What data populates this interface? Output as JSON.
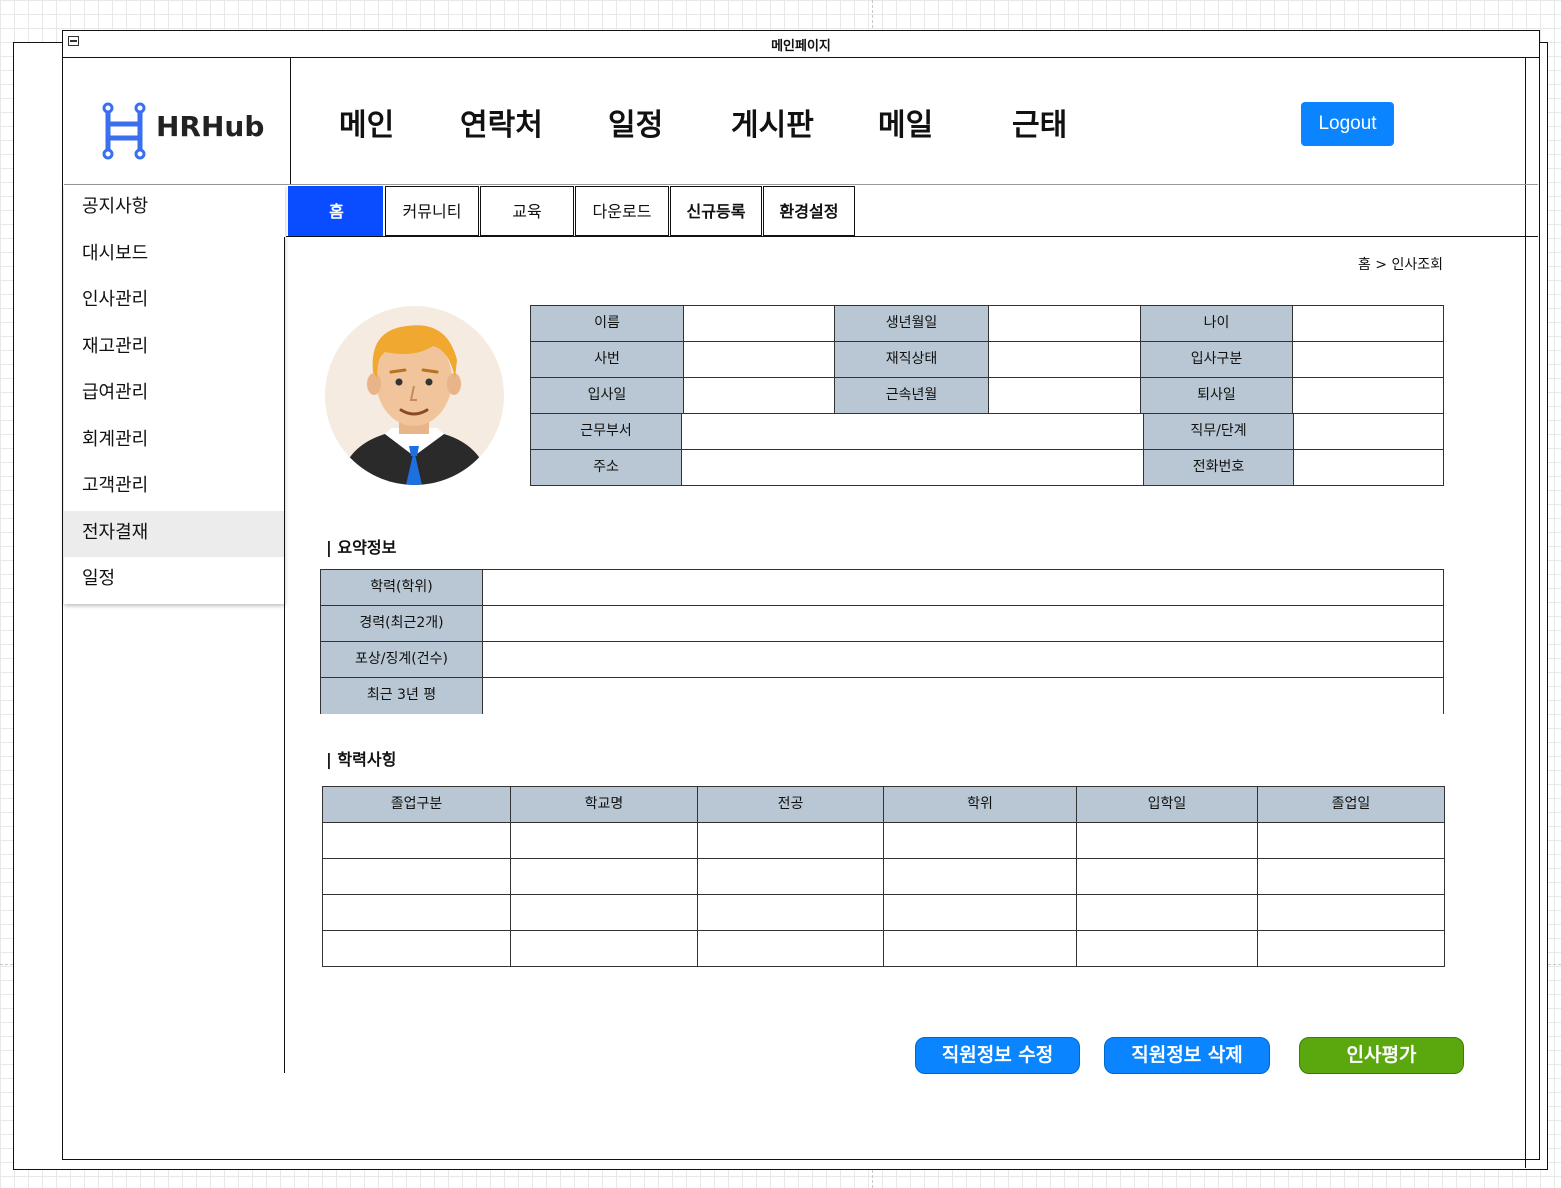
{
  "window": {
    "title": "메인페이지"
  },
  "brand": {
    "name": "HRHub",
    "logo_color": "#3a6ff0"
  },
  "topnav": {
    "items": [
      {
        "label": "메인"
      },
      {
        "label": "연락처"
      },
      {
        "label": "일정"
      },
      {
        "label": "게시판"
      },
      {
        "label": "메일"
      },
      {
        "label": "근태"
      }
    ],
    "logout_label": "Logout"
  },
  "sidebar": {
    "items": [
      {
        "label": "공지사항"
      },
      {
        "label": "대시보드"
      },
      {
        "label": "인사관리"
      },
      {
        "label": "재고관리"
      },
      {
        "label": "급여관리"
      },
      {
        "label": "회계관리"
      },
      {
        "label": "고객관리"
      },
      {
        "label": "전자결재",
        "active": true
      },
      {
        "label": "일정"
      }
    ]
  },
  "tabs": {
    "items": [
      {
        "label": "홈",
        "active": true
      },
      {
        "label": "커뮤니티"
      },
      {
        "label": "교육"
      },
      {
        "label": "다운로드"
      },
      {
        "label": "신규등록"
      },
      {
        "label": "환경설정"
      }
    ]
  },
  "breadcrumb": "홈 > 인사조회",
  "profile": {
    "rows3": [
      [
        "이름",
        "생년월일",
        "나이"
      ],
      [
        "사번",
        "재직상태",
        "입사구분"
      ],
      [
        "입사일",
        "근속년월",
        "퇴사일"
      ]
    ],
    "rows2": [
      [
        "근무부서",
        "직무/단계"
      ],
      [
        "주소",
        "전화번호"
      ]
    ]
  },
  "summary": {
    "title": "| 요약정보",
    "labels": [
      "학력(학위)",
      "경력(최근2개)",
      "포상/징계(건수)",
      "최근 3년 평"
    ]
  },
  "education": {
    "title": "| 학력사힝",
    "columns": [
      "졸업구분",
      "학교명",
      "전공",
      "학위",
      "입학일",
      "졸업일"
    ],
    "row_count": 4
  },
  "actions": {
    "edit_label": "직원정보 수정",
    "delete_label": "직원정보 삭제",
    "eval_label": "인사평가"
  },
  "colors": {
    "accent_blue": "#0a84ff",
    "tab_active": "#0a4cff",
    "eval_green": "#5aa80e",
    "label_bg": "#b8c7d3"
  }
}
